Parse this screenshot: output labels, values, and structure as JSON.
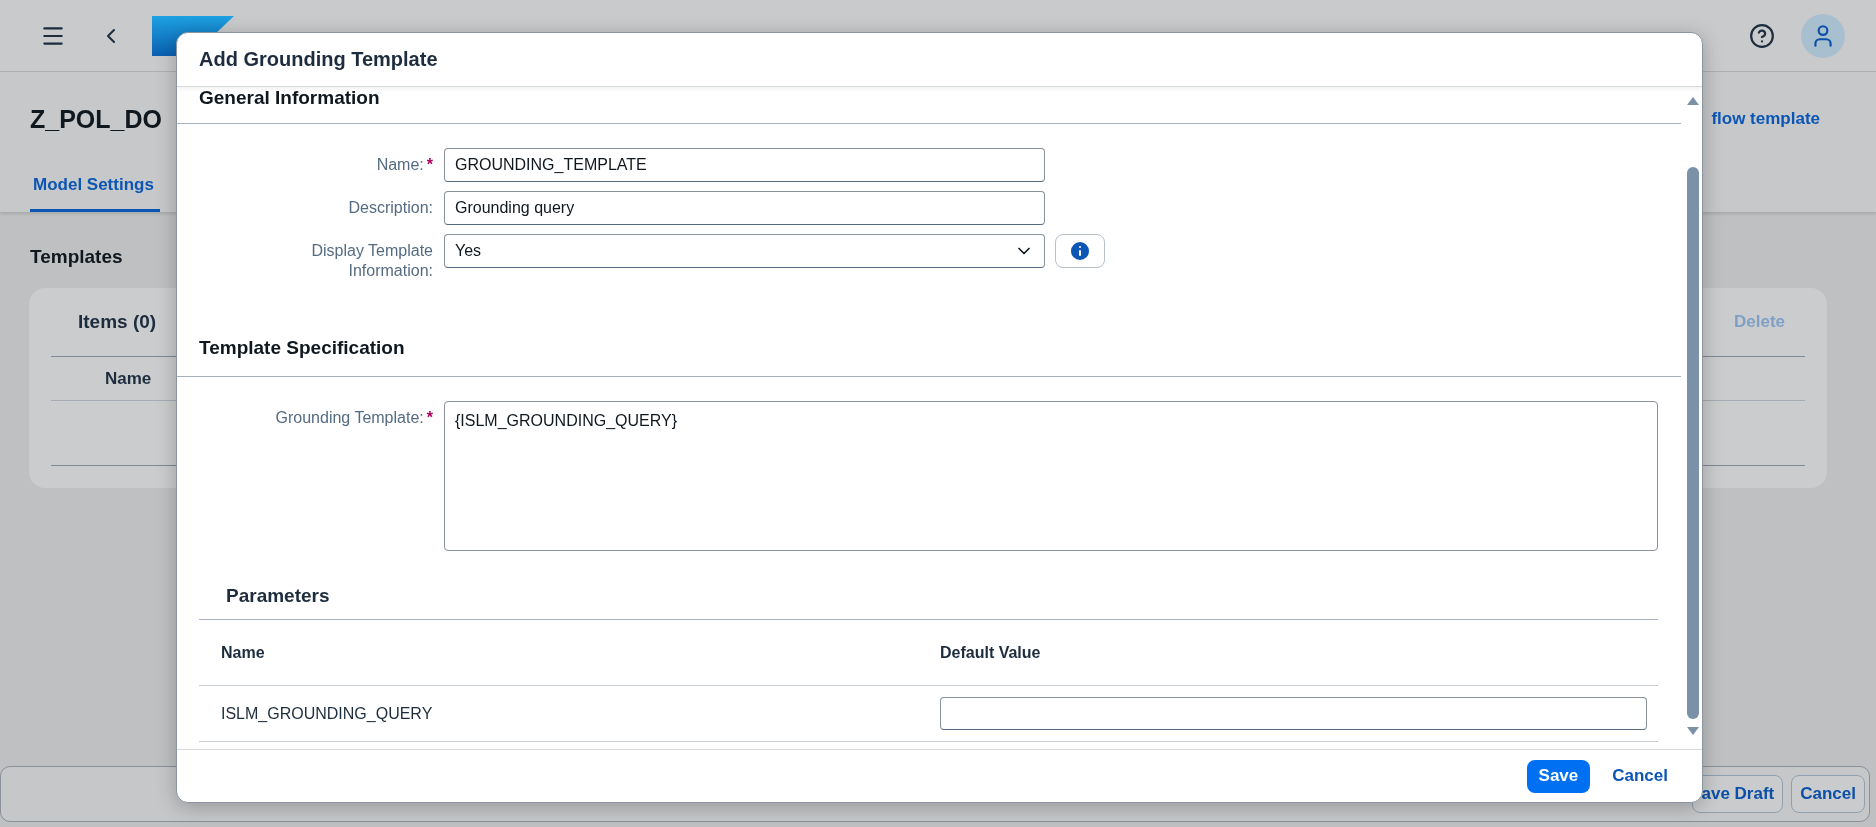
{
  "page": {
    "title": "Z_POL_DO",
    "header_link": "flow template",
    "tabs": [
      {
        "label": "Model Settings",
        "selected": true
      }
    ],
    "section_title": "Templates",
    "table": {
      "title": "Items (0)",
      "action": {
        "label": "Delete",
        "disabled": true
      },
      "columns": [
        "Name"
      ]
    },
    "footer_buttons": [
      "ave Draft",
      "Cancel"
    ]
  },
  "dialog": {
    "title": "Add Grounding Template",
    "sections": [
      {
        "title": "General Information",
        "fields": [
          {
            "kind": "text",
            "label": "Name:",
            "required_mark": "*",
            "value": "GROUNDING_TEMPLATE"
          },
          {
            "kind": "text",
            "label": "Description:",
            "value": "Grounding query"
          },
          {
            "kind": "select",
            "label": "Display Template Information:",
            "value": "Yes",
            "info": true
          }
        ]
      },
      {
        "title": "Template Specification",
        "fields": [
          {
            "kind": "textarea",
            "label": "Grounding Template:",
            "required_mark": "*",
            "value": "{ISLM_GROUNDING_QUERY}"
          }
        ]
      }
    ],
    "parameters": {
      "title": "Parameters",
      "columns": [
        "Name",
        "Default Value"
      ],
      "rows": [
        {
          "name": "ISLM_GROUNDING_QUERY",
          "default_value": ""
        }
      ]
    },
    "buttons": [
      {
        "label": "Save",
        "kind": "primary"
      },
      {
        "label": "Cancel",
        "kind": "transparent"
      }
    ]
  }
}
